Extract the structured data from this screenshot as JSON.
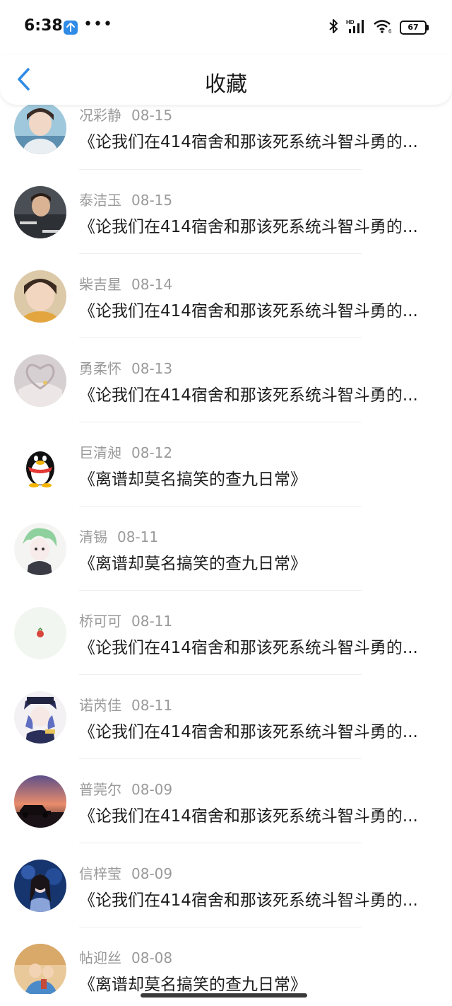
{
  "status": {
    "time": "6:38",
    "battery": "67"
  },
  "header": {
    "title": "收藏"
  },
  "items": [
    {
      "name": "况彩静",
      "date": "08-15",
      "title": "《论我们在414宿舍和那该死系统斗智斗勇的..."
    },
    {
      "name": "泰洁玉",
      "date": "08-15",
      "title": "《论我们在414宿舍和那该死系统斗智斗勇的..."
    },
    {
      "name": "柴吉星",
      "date": "08-14",
      "title": "《论我们在414宿舍和那该死系统斗智斗勇的..."
    },
    {
      "name": "勇柔怀",
      "date": "08-13",
      "title": "《论我们在414宿舍和那该死系统斗智斗勇的..."
    },
    {
      "name": "巨清昶",
      "date": "08-12",
      "title": "《离谱却莫名搞笑的查九日常》"
    },
    {
      "name": "清锡",
      "date": "08-11",
      "title": "《离谱却莫名搞笑的查九日常》"
    },
    {
      "name": "桥可可",
      "date": "08-11",
      "title": "《论我们在414宿舍和那该死系统斗智斗勇的..."
    },
    {
      "name": "诺芮佳",
      "date": "08-11",
      "title": "《论我们在414宿舍和那该死系统斗智斗勇的..."
    },
    {
      "name": "普莞尔",
      "date": "08-09",
      "title": "《论我们在414宿舍和那该死系统斗智斗勇的..."
    },
    {
      "name": "信梓莹",
      "date": "08-09",
      "title": "《论我们在414宿舍和那该死系统斗智斗勇的..."
    },
    {
      "name": "帖迎丝",
      "date": "08-08",
      "title": "《离谱却莫名搞笑的查九日常》"
    }
  ],
  "colors": {
    "accent": "#2f8be6",
    "meta_text": "#9a9a9a",
    "title_text": "#1c1c1c"
  }
}
